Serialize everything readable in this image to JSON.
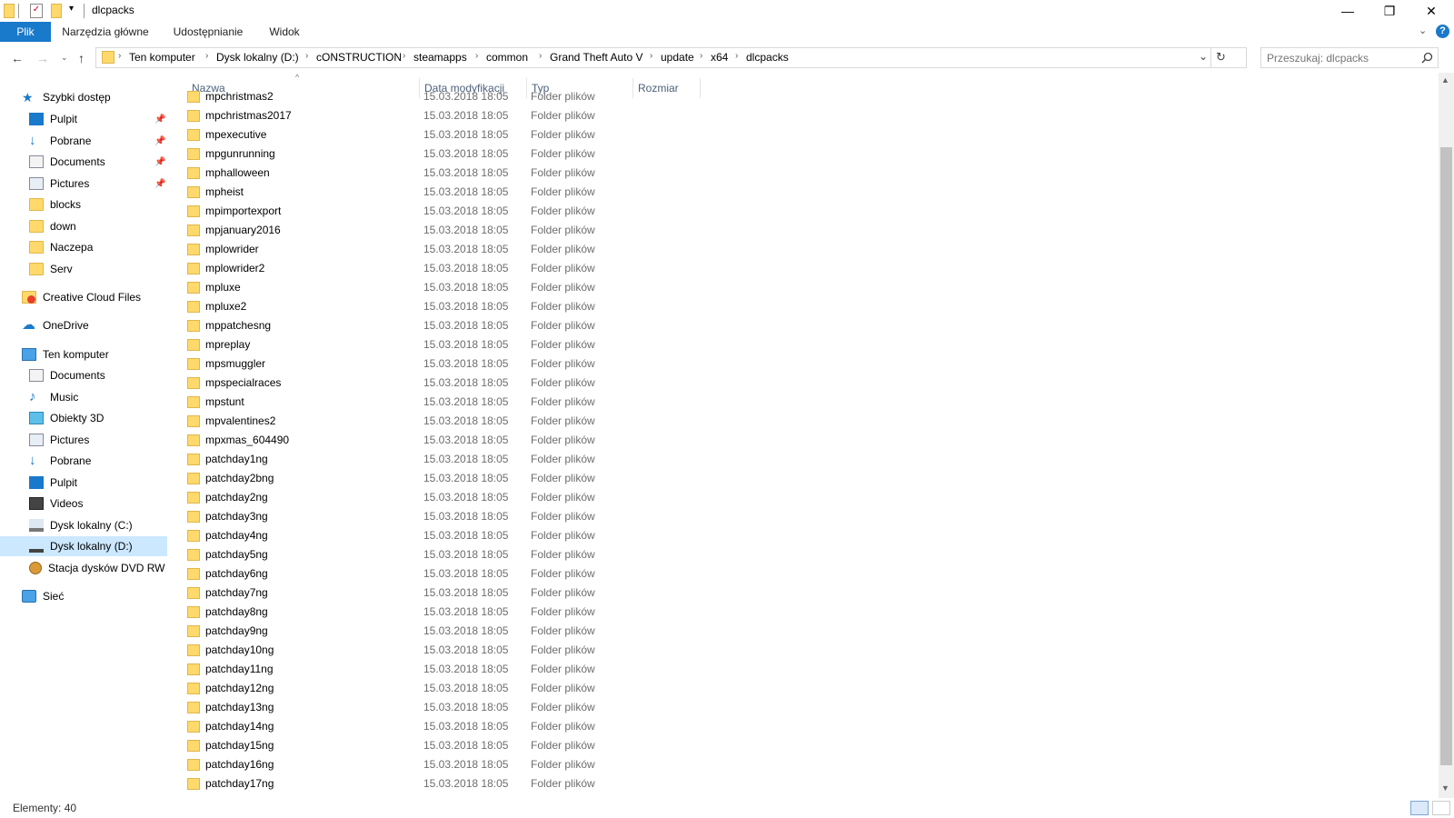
{
  "window": {
    "title": "dlcpacks"
  },
  "ribbon": {
    "tabs": [
      "Plik",
      "Narzędzia główne",
      "Udostępnianie",
      "Widok"
    ]
  },
  "address": {
    "crumbs": [
      "Ten komputer",
      "Dysk lokalny (D:)",
      "cONSTRUCTION",
      "steamapps",
      "common",
      "Grand Theft Auto V",
      "update",
      "x64",
      "dlcpacks"
    ]
  },
  "search": {
    "placeholder": "Przeszukaj: dlcpacks"
  },
  "nav": {
    "quick_access": "Szybki dostęp",
    "quick_items": [
      "Pulpit",
      "Pobrane",
      "Documents",
      "Pictures",
      "blocks",
      "down",
      "Naczepa",
      "Serv"
    ],
    "creative_cloud": "Creative Cloud Files",
    "onedrive": "OneDrive",
    "this_pc": "Ten komputer",
    "pc_items": [
      "Documents",
      "Music",
      "Obiekty 3D",
      "Pictures",
      "Pobrane",
      "Pulpit",
      "Videos",
      "Dysk lokalny (C:)",
      "Dysk lokalny (D:)",
      "Stacja dysków DVD RW (E"
    ],
    "network": "Sieć"
  },
  "columns": {
    "name": "Nazwa",
    "date": "Data modyfikacji",
    "type": "Typ",
    "size": "Rozmiar"
  },
  "files": [
    {
      "name": "mpchristmas2",
      "date": "15.03.2018 18:05",
      "type": "Folder plików"
    },
    {
      "name": "mpchristmas2017",
      "date": "15.03.2018 18:05",
      "type": "Folder plików"
    },
    {
      "name": "mpexecutive",
      "date": "15.03.2018 18:05",
      "type": "Folder plików"
    },
    {
      "name": "mpgunrunning",
      "date": "15.03.2018 18:05",
      "type": "Folder plików"
    },
    {
      "name": "mphalloween",
      "date": "15.03.2018 18:05",
      "type": "Folder plików"
    },
    {
      "name": "mpheist",
      "date": "15.03.2018 18:05",
      "type": "Folder plików"
    },
    {
      "name": "mpimportexport",
      "date": "15.03.2018 18:05",
      "type": "Folder plików"
    },
    {
      "name": "mpjanuary2016",
      "date": "15.03.2018 18:05",
      "type": "Folder plików"
    },
    {
      "name": "mplowrider",
      "date": "15.03.2018 18:05",
      "type": "Folder plików"
    },
    {
      "name": "mplowrider2",
      "date": "15.03.2018 18:05",
      "type": "Folder plików"
    },
    {
      "name": "mpluxe",
      "date": "15.03.2018 18:05",
      "type": "Folder plików"
    },
    {
      "name": "mpluxe2",
      "date": "15.03.2018 18:05",
      "type": "Folder plików"
    },
    {
      "name": "mppatchesng",
      "date": "15.03.2018 18:05",
      "type": "Folder plików"
    },
    {
      "name": "mpreplay",
      "date": "15.03.2018 18:05",
      "type": "Folder plików"
    },
    {
      "name": "mpsmuggler",
      "date": "15.03.2018 18:05",
      "type": "Folder plików"
    },
    {
      "name": "mpspecialraces",
      "date": "15.03.2018 18:05",
      "type": "Folder plików"
    },
    {
      "name": "mpstunt",
      "date": "15.03.2018 18:05",
      "type": "Folder plików"
    },
    {
      "name": "mpvalentines2",
      "date": "15.03.2018 18:05",
      "type": "Folder plików"
    },
    {
      "name": "mpxmas_604490",
      "date": "15.03.2018 18:05",
      "type": "Folder plików"
    },
    {
      "name": "patchday1ng",
      "date": "15.03.2018 18:05",
      "type": "Folder plików"
    },
    {
      "name": "patchday2bng",
      "date": "15.03.2018 18:05",
      "type": "Folder plików"
    },
    {
      "name": "patchday2ng",
      "date": "15.03.2018 18:05",
      "type": "Folder plików"
    },
    {
      "name": "patchday3ng",
      "date": "15.03.2018 18:05",
      "type": "Folder plików"
    },
    {
      "name": "patchday4ng",
      "date": "15.03.2018 18:05",
      "type": "Folder plików"
    },
    {
      "name": "patchday5ng",
      "date": "15.03.2018 18:05",
      "type": "Folder plików"
    },
    {
      "name": "patchday6ng",
      "date": "15.03.2018 18:05",
      "type": "Folder plików"
    },
    {
      "name": "patchday7ng",
      "date": "15.03.2018 18:05",
      "type": "Folder plików"
    },
    {
      "name": "patchday8ng",
      "date": "15.03.2018 18:05",
      "type": "Folder plików"
    },
    {
      "name": "patchday9ng",
      "date": "15.03.2018 18:05",
      "type": "Folder plików"
    },
    {
      "name": "patchday10ng",
      "date": "15.03.2018 18:05",
      "type": "Folder plików"
    },
    {
      "name": "patchday11ng",
      "date": "15.03.2018 18:05",
      "type": "Folder plików"
    },
    {
      "name": "patchday12ng",
      "date": "15.03.2018 18:05",
      "type": "Folder plików"
    },
    {
      "name": "patchday13ng",
      "date": "15.03.2018 18:05",
      "type": "Folder plików"
    },
    {
      "name": "patchday14ng",
      "date": "15.03.2018 18:05",
      "type": "Folder plików"
    },
    {
      "name": "patchday15ng",
      "date": "15.03.2018 18:05",
      "type": "Folder plików"
    },
    {
      "name": "patchday16ng",
      "date": "15.03.2018 18:05",
      "type": "Folder plików"
    },
    {
      "name": "patchday17ng",
      "date": "15.03.2018 18:05",
      "type": "Folder plików"
    }
  ],
  "status": {
    "count": "Elementy: 40"
  },
  "colors": {
    "accent": "#1979ca",
    "selection": "#cce8ff",
    "folder": "#ffd96b"
  }
}
